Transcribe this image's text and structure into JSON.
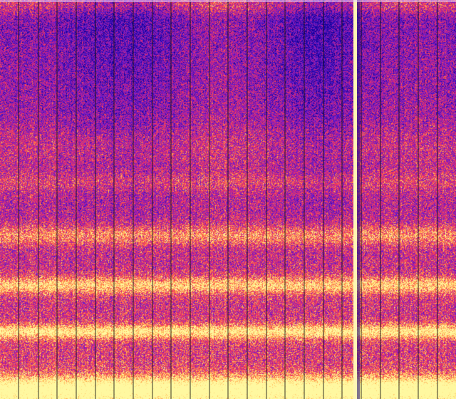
{
  "view": "waterfall-spectrogram",
  "palette": {
    "low": "#14009a",
    "mid_low": "#6a1ed0",
    "mid": "#c81f8c",
    "mid_high": "#ff4a4a",
    "high": "#ffb04a",
    "peak": "#fff8a0",
    "gridline": "#111111",
    "signal_line": "#fff6b4"
  },
  "description_of_pattern": {
    "frequency_direction": "bottom-is-low",
    "gridlines": "vertical",
    "continuous_signal": "single-vertical-bright-line"
  }
}
